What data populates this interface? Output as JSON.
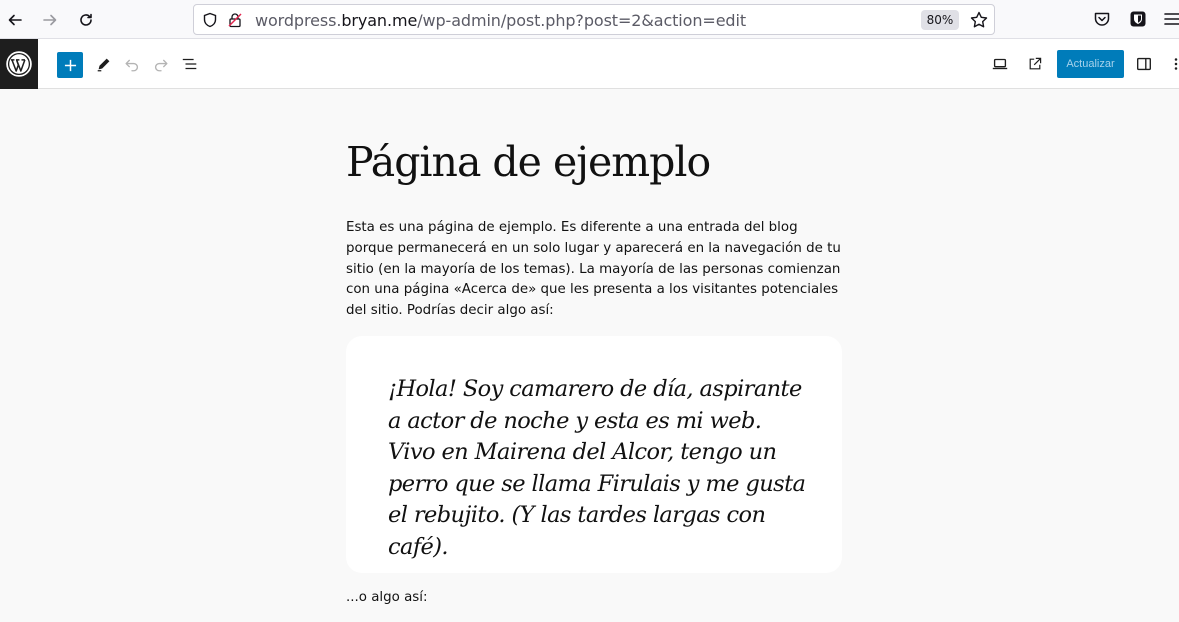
{
  "browser": {
    "url_prefix": "wordpress.",
    "url_domain": "bryan.me",
    "url_path": "/wp-admin/post.php?post=2&action=edit",
    "zoom": "80%"
  },
  "editor": {
    "update_label": "Actualizar"
  },
  "post": {
    "title": "Página de ejemplo",
    "intro": "Esta es una página de ejemplo. Es diferente a una entrada del blog porque permanecerá en un solo lugar y aparecerá en la navegación de tu sitio (en la mayoría de los temas). La mayoría de las personas comienzan con una página «Acerca de» que les presenta a los visitantes potenciales del sitio. Podrías decir algo así:",
    "quote": "¡Hola! Soy camarero de día, aspirante a actor de noche y esta es mi web. Vivo en Mairena del Alcor, tengo un perro que se llama Firulais y me gusta el rebujito. (Y las tardes largas con café).",
    "outro": "...o algo así:"
  },
  "colors": {
    "accent": "#007cba",
    "wp_logo_bg": "#1e1e1e",
    "canvas_bg": "#f9f9f9"
  }
}
